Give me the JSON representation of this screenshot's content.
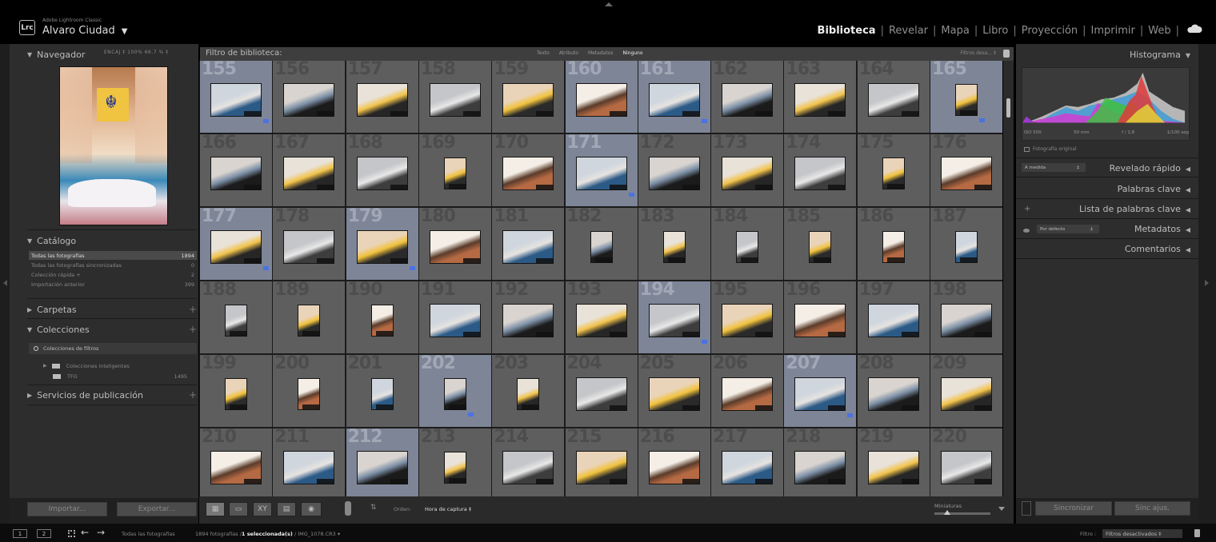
{
  "identity": {
    "logo": "Lrc",
    "app_name": "Adobe Lightroom Classic",
    "user": "Alvaro Ciudad"
  },
  "modules": [
    "Biblioteca",
    "Revelar",
    "Mapa",
    "Libro",
    "Proyección",
    "Imprimir",
    "Web"
  ],
  "active_module": "Biblioteca",
  "navigator": {
    "title": "Navegador",
    "zoom": "ENCAJ ‡  100%   66.7 % ‡"
  },
  "catalog": {
    "title": "Catálogo",
    "rows": [
      {
        "label": "Todas las fotografías",
        "count": "1894"
      },
      {
        "label": "Todas las fotografías sincronizadas",
        "count": "0"
      },
      {
        "label": "Colección rápida +",
        "count": "2"
      },
      {
        "label": "Importación anterior",
        "count": "399"
      }
    ]
  },
  "folders": {
    "title": "Carpetas"
  },
  "collections": {
    "title": "Colecciones",
    "filter": "Colecciones de filtros",
    "rows": [
      {
        "label": "Colecciones inteligentes",
        "count": ""
      },
      {
        "label": "TFG",
        "count": "1495"
      }
    ]
  },
  "publish": {
    "title": "Servicios de publicación"
  },
  "left_buttons": {
    "import": "Importar...",
    "export": "Exportar..."
  },
  "library_filter": {
    "title": "Filtro de biblioteca:",
    "tabs": [
      "Texto",
      "Atributo",
      "Metadatos",
      "Ninguno"
    ],
    "active_tab": "Ninguno",
    "preset": "Filtros desa... ‡"
  },
  "grid": {
    "rows": [
      {
        "nums": [
          "155",
          "156",
          "157",
          "158",
          "159",
          "160",
          "161",
          "162",
          "163",
          "164",
          "165"
        ]
      },
      {
        "nums": [
          "166",
          "167",
          "168",
          "169",
          "170",
          "171",
          "172",
          "173",
          "174",
          "175",
          "176"
        ]
      },
      {
        "nums": [
          "177",
          "178",
          "179",
          "180",
          "181",
          "182",
          "183",
          "184",
          "185",
          "186",
          "187"
        ]
      },
      {
        "nums": [
          "188",
          "189",
          "190",
          "191",
          "192",
          "193",
          "194",
          "195",
          "196",
          "197",
          "198"
        ]
      },
      {
        "nums": [
          "199",
          "200",
          "201",
          "202",
          "203",
          "204",
          "205",
          "206",
          "207",
          "208",
          "209"
        ]
      },
      {
        "nums": [
          "210",
          "211",
          "212",
          "213",
          "214",
          "215",
          "216",
          "217",
          "218",
          "219",
          "220"
        ]
      }
    ],
    "selected": [
      "155",
      "160",
      "161",
      "165",
      "171",
      "177",
      "179",
      "194",
      "202",
      "207",
      "212"
    ],
    "flagged": [
      "155",
      "161",
      "165",
      "171",
      "177",
      "179",
      "194",
      "202",
      "207"
    ]
  },
  "toolbar": {
    "sort_label": "Orden:",
    "sort_value": "Hora de captura ‡",
    "thumb_label": "Miniaturas"
  },
  "right_panel": {
    "histogram": "Histograma",
    "hist_info": [
      "ISO 500",
      "50 mm",
      "f / 2,8",
      "1/100 seg"
    ],
    "original": "Fotografía original",
    "quick_develop": "Revelado rápido",
    "quick_develop_preset": "A medida",
    "keywording": "Palabras clave",
    "keyword_list": "Lista de palabras clave",
    "metadata": "Metadatos",
    "metadata_preset": "Por defecto",
    "comments": "Comentarios",
    "sync": "Sincronizar",
    "sync_settings": "Sinc ajus."
  },
  "filmstrip": {
    "screen1": "1",
    "screen2": "2",
    "source": "Todas las fotografías",
    "info_count": "1894 fotografías /",
    "info_selected": "1 seleccionada(s)",
    "info_file": "/ IMG_1078.CR3 ▾",
    "filter_label": "Filtro :",
    "filter_value": "Filtros desactivados ‡"
  },
  "colors": {
    "panel": "#2d2d2d",
    "grid_cell": "#5e5e5e",
    "grid_cell_selected": "#7d8597",
    "flag_blue": "#4c72e0"
  }
}
